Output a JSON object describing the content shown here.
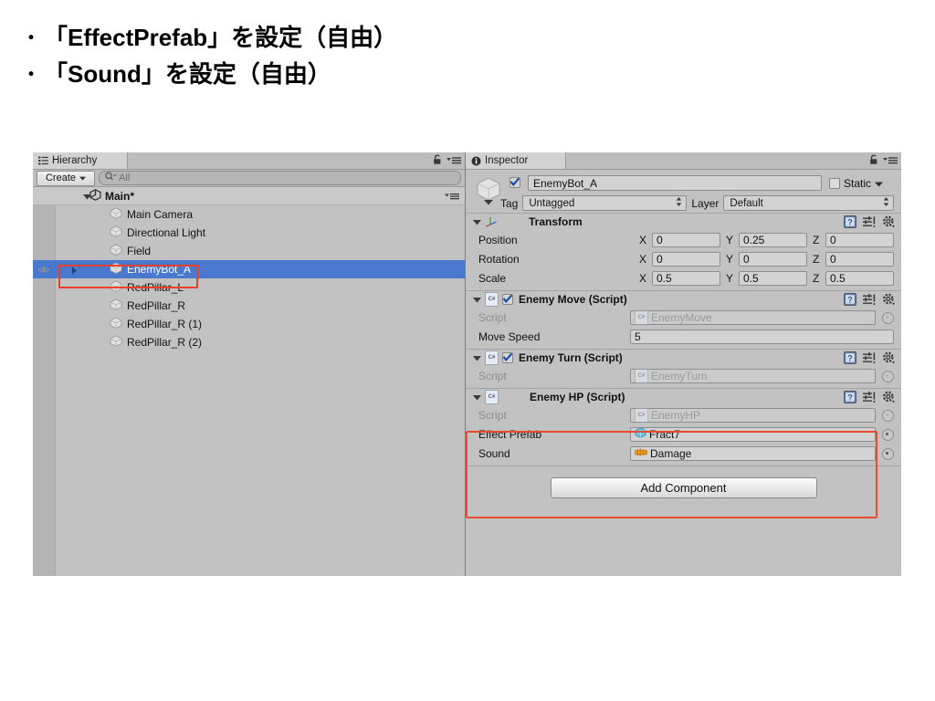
{
  "slide": {
    "bullets": [
      {
        "marker": "・",
        "text": "「EffectPrefab」を設定（自由）"
      },
      {
        "marker": "・",
        "text": "「Sound」を設定（自由）"
      }
    ]
  },
  "colors": {
    "selection_blue": "#4a78cf",
    "highlight_red": "#ec4a2e",
    "panel_gray": "#c2c2c2"
  },
  "hierarchy": {
    "tab_label": "Hierarchy",
    "create_label": "Create",
    "search_placeholder": "All",
    "search_value": "",
    "scene_name": "Main*",
    "objects": [
      {
        "label": "Main Camera",
        "selected": false,
        "expandable": false
      },
      {
        "label": "Directional Light",
        "selected": false,
        "expandable": false
      },
      {
        "label": "Field",
        "selected": false,
        "expandable": false
      },
      {
        "label": "EnemyBot_A",
        "selected": true,
        "expandable": true
      },
      {
        "label": "RedPillar_L",
        "selected": false,
        "expandable": false
      },
      {
        "label": "RedPillar_R",
        "selected": false,
        "expandable": false
      },
      {
        "label": "RedPillar_R (1)",
        "selected": false,
        "expandable": false
      },
      {
        "label": "RedPillar_R (2)",
        "selected": false,
        "expandable": false
      }
    ]
  },
  "inspector": {
    "tab_label": "Inspector",
    "object_name": "EnemyBot_A",
    "object_enabled": true,
    "static_label": "Static",
    "static_checked": false,
    "tag_label": "Tag",
    "tag_value": "Untagged",
    "layer_label": "Layer",
    "layer_value": "Default",
    "components": [
      {
        "name": "Transform",
        "has_checkbox": false,
        "rows": [
          {
            "label": "Position",
            "x": "0",
            "y": "0.25",
            "z": "0"
          },
          {
            "label": "Rotation",
            "x": "0",
            "y": "0",
            "z": "0"
          },
          {
            "label": "Scale",
            "x": "0.5",
            "y": "0.5",
            "z": "0.5"
          }
        ],
        "axis_labels": {
          "x": "X",
          "y": "Y",
          "z": "Z"
        }
      },
      {
        "name": "Enemy Move (Script)",
        "has_checkbox": true,
        "checked": true,
        "script_label": "Script",
        "script_value": "EnemyMove",
        "fields": [
          {
            "label": "Move Speed",
            "value": "5"
          }
        ]
      },
      {
        "name": "Enemy Turn (Script)",
        "has_checkbox": true,
        "checked": true,
        "script_label": "Script",
        "script_value": "EnemyTurn",
        "fields": []
      },
      {
        "name": "Enemy HP (Script)",
        "has_checkbox": false,
        "highlighted": true,
        "script_label": "Script",
        "script_value": "EnemyHP",
        "object_fields": [
          {
            "label": "Effect Prefab",
            "value": "Fract7",
            "icon": "prefab-cube-icon"
          },
          {
            "label": "Sound",
            "value": "Damage",
            "icon": "audioclip-icon"
          }
        ]
      }
    ],
    "add_component_label": "Add Component"
  }
}
